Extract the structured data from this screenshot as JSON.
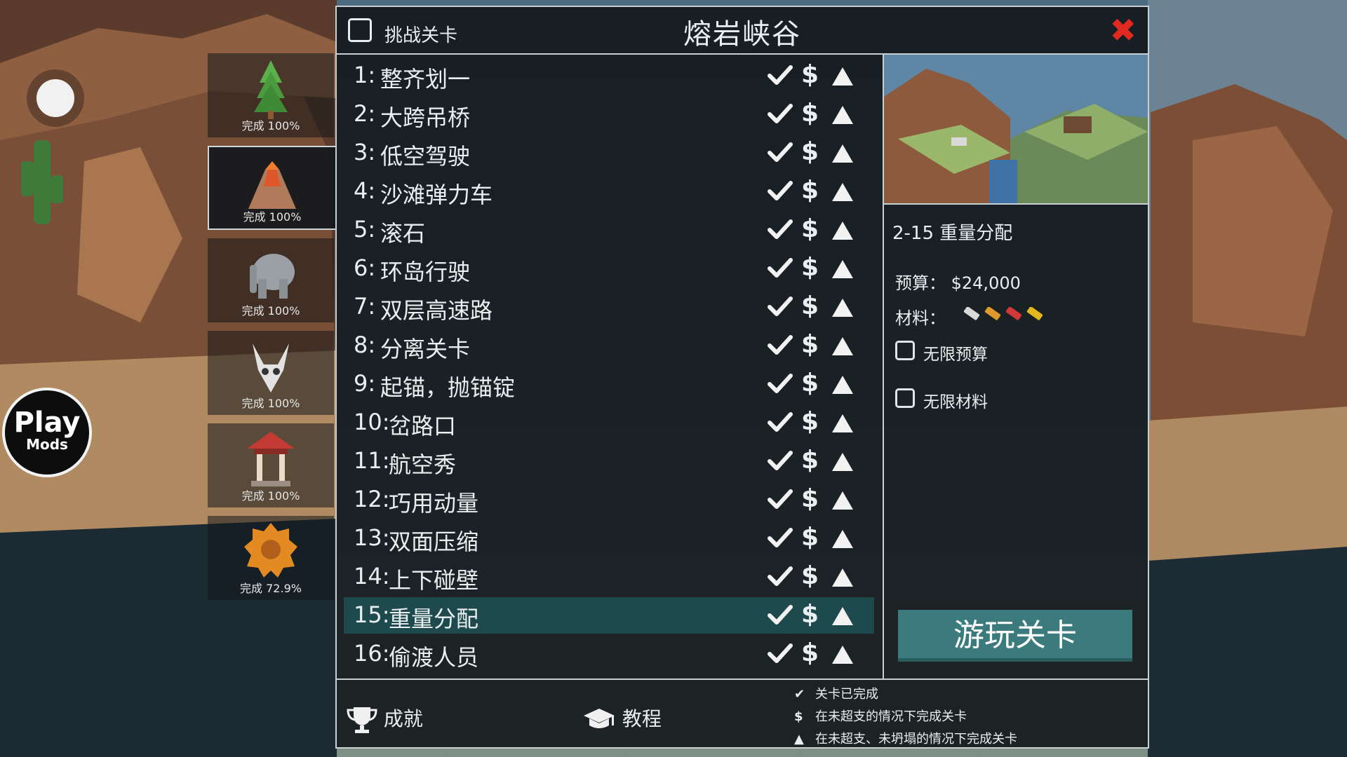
{
  "overlay": {
    "mods_logo_line1": "Play",
    "mods_logo_line2": "Mods"
  },
  "world_tabs": [
    {
      "icon": "tree-icon",
      "progress_label": "完成 100%",
      "progress": 100
    },
    {
      "icon": "volcano-icon",
      "progress_label": "完成 100%",
      "progress": 100,
      "active": true
    },
    {
      "icon": "elephant-icon",
      "progress_label": "完成 100%",
      "progress": 100
    },
    {
      "icon": "skull-icon",
      "progress_label": "完成 100%",
      "progress": 100
    },
    {
      "icon": "temple-icon",
      "progress_label": "完成 100%",
      "progress": 100
    },
    {
      "icon": "gear-icon",
      "progress_label": "完成 72.9%",
      "progress": 72.9
    }
  ],
  "panel": {
    "title": "熔岩峡谷",
    "challenge_label": "挑战关卡",
    "close_icon": "close-icon"
  },
  "levels": [
    {
      "num": "1:",
      "name": "整齐划一"
    },
    {
      "num": "2:",
      "name": "大跨吊桥"
    },
    {
      "num": "3:",
      "name": "低空驾驶"
    },
    {
      "num": "4:",
      "name": "沙滩弹力车"
    },
    {
      "num": "5:",
      "name": "滚石"
    },
    {
      "num": "6:",
      "name": "环岛行驶"
    },
    {
      "num": "7:",
      "name": "双层高速路"
    },
    {
      "num": "8:",
      "name": "分离关卡"
    },
    {
      "num": "9:",
      "name": "起锚，抛锚锭"
    },
    {
      "num": "10:",
      "name": "岔路口"
    },
    {
      "num": "11:",
      "name": "航空秀"
    },
    {
      "num": "12:",
      "name": "巧用动量"
    },
    {
      "num": "13:",
      "name": "双面压缩"
    },
    {
      "num": "14:",
      "name": "上下碰壁"
    },
    {
      "num": "15:",
      "name": "重量分配",
      "selected": true
    },
    {
      "num": "16:",
      "name": "偷渡人员"
    }
  ],
  "status_symbols": {
    "dollar": "$"
  },
  "info": {
    "level_title": "2-15  重量分配",
    "budget": "预算：  $24,000",
    "materials_label": "材料：",
    "material_icons": [
      "road-icon",
      "wood-icon",
      "steel-icon",
      "rope-icon"
    ],
    "material_colors": [
      "#d9d9d9",
      "#e09a2b",
      "#d23838",
      "#e6b820"
    ],
    "unlimited_budget": "无限预算",
    "unlimited_materials": "无限材料",
    "play_button": "游玩关卡"
  },
  "footer": {
    "achievements": "成就",
    "tutorial": "教程",
    "legend": [
      {
        "symbol": "✔",
        "text": "关卡已完成"
      },
      {
        "symbol": "$",
        "text": "在未超支的情况下完成关卡"
      },
      {
        "symbol": "▲",
        "text": "在未超支、未坍塌的情况下完成关卡"
      }
    ]
  },
  "colors": {
    "accent": "#3b7b7d",
    "selected_row": "#1f4a4d",
    "close": "#e02a1f"
  }
}
